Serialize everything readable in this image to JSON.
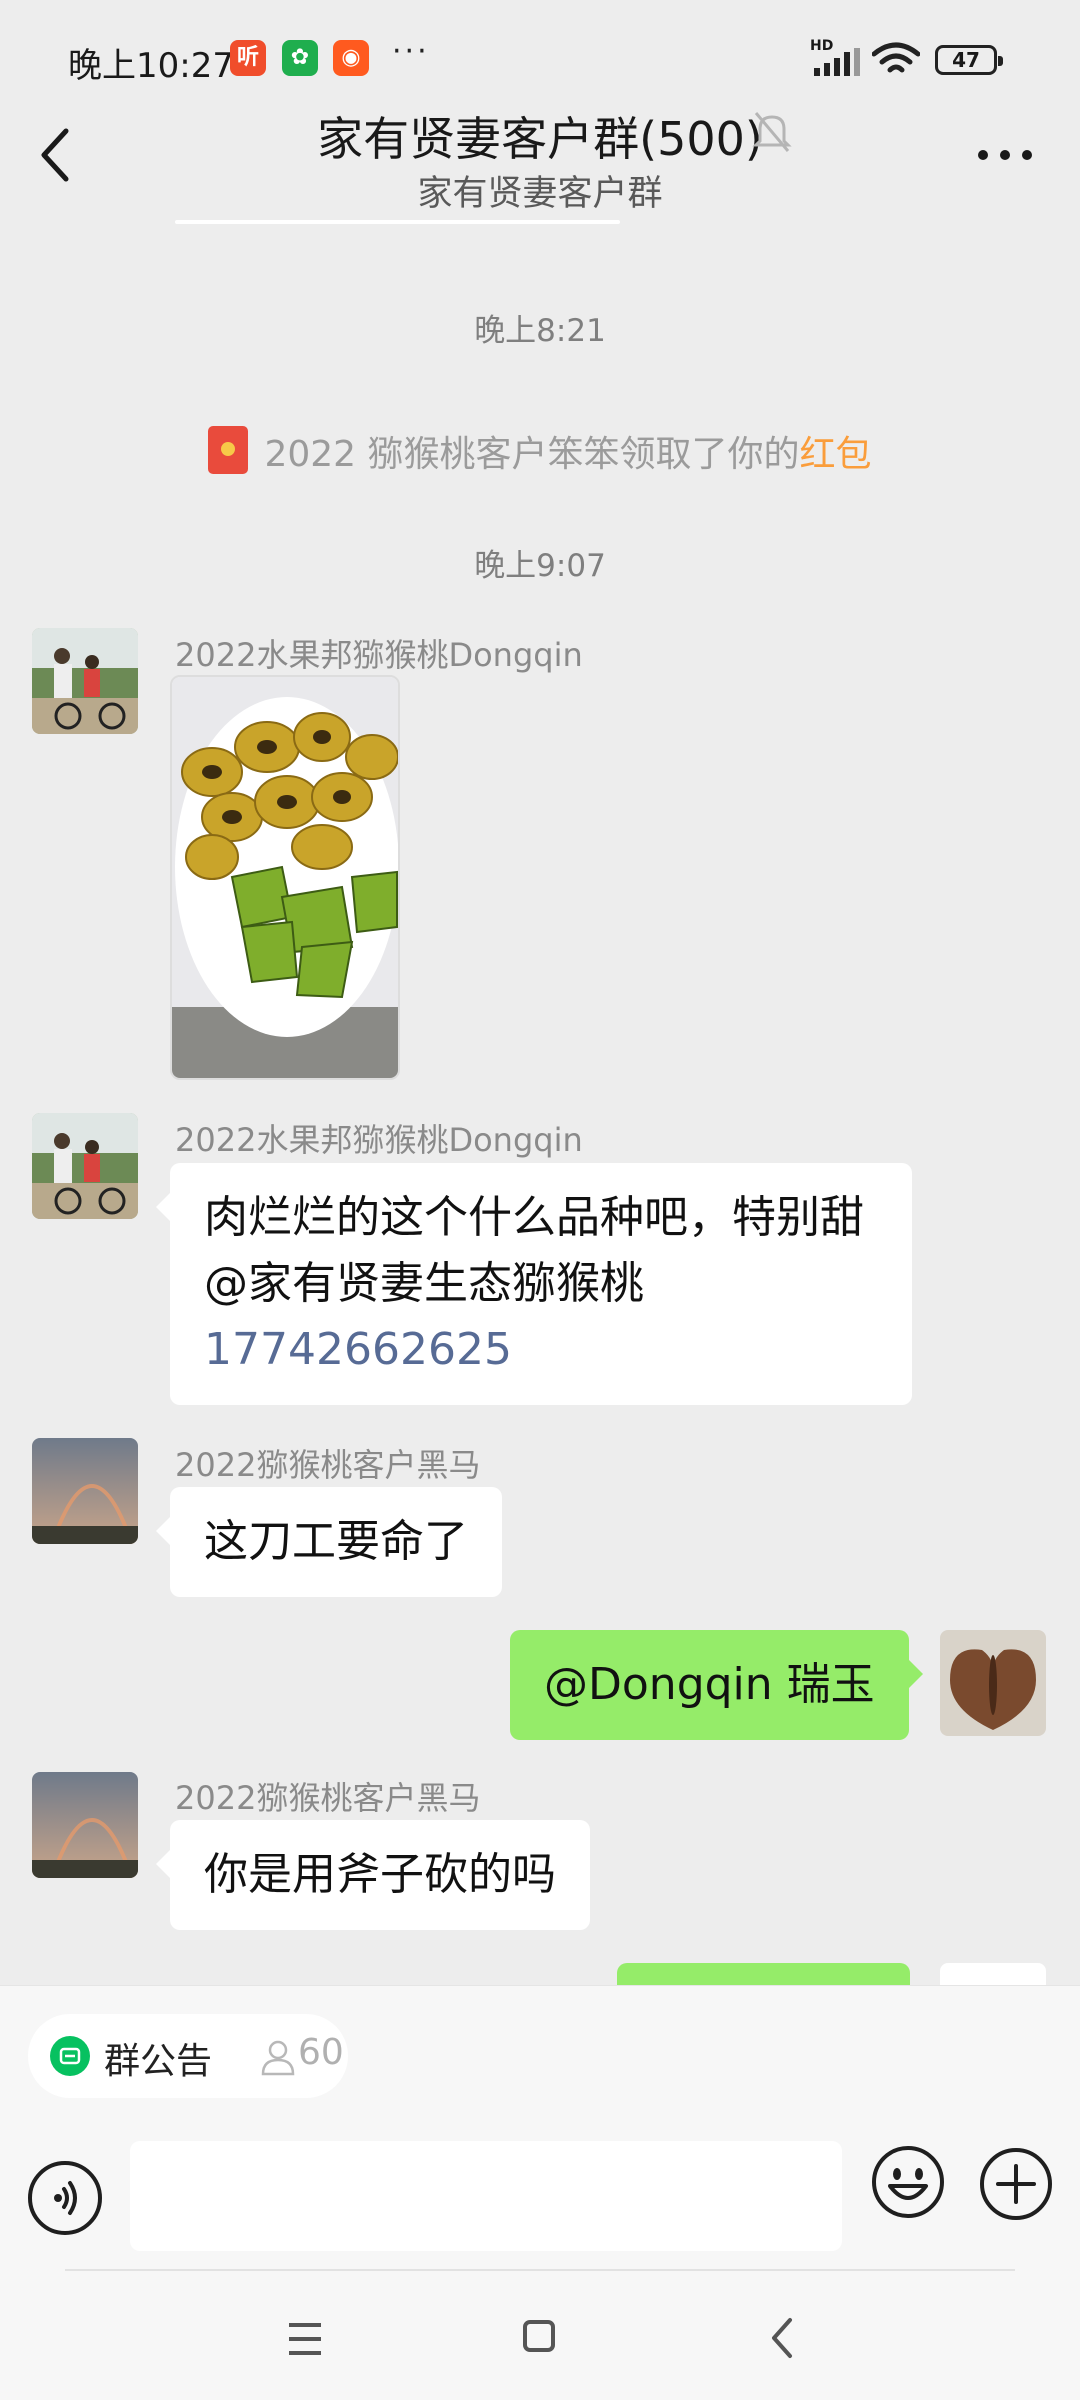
{
  "status_bar": {
    "time": "晚上10:27",
    "notif_apps": [
      {
        "icon": "ting-app-icon",
        "glyph": "听",
        "color": "#f04d2b"
      },
      {
        "icon": "leaf-app-icon",
        "glyph": "✿",
        "color": "#1fae4e"
      },
      {
        "icon": "kuaishou-app-icon",
        "glyph": "◉",
        "color": "#ff5a1f"
      }
    ],
    "more_dots": "···",
    "network": "HD",
    "battery": "47"
  },
  "header": {
    "title": "家有贤妻客户群(500)",
    "subtitle": "家有贤妻客户群"
  },
  "messages": {
    "time1": "晚上8:21",
    "redpacket_text": "2022 猕猴桃客户笨笨领取了你的",
    "redpacket_link": "红包",
    "time2": "晚上9:07",
    "m1_sender": "2022水果邦猕猴桃Dongqin",
    "m2_sender": "2022水果邦猕猴桃Dongqin",
    "m2_line1": "肉烂烂的这个什么品种吧，特别甜",
    "m2_line2": "@家有贤妻生态猕猴桃",
    "m2_phone": "17742662625",
    "m3_sender": "2022猕猴桃客户黑马",
    "m3_text": "这刀工要命了",
    "m4_text": "@Dongqin  瑞玉",
    "m5_sender": "2022猕猴桃客户黑马",
    "m5_text": "你是用斧子砍的吗"
  },
  "bottom": {
    "notice_label": "群公告",
    "notice_count": "60"
  },
  "colors": {
    "background": "#ededed",
    "my_bubble": "#95ec69",
    "link": "#576b95",
    "redpacket": "#fa9d3b",
    "wechat_green": "#07c160"
  }
}
